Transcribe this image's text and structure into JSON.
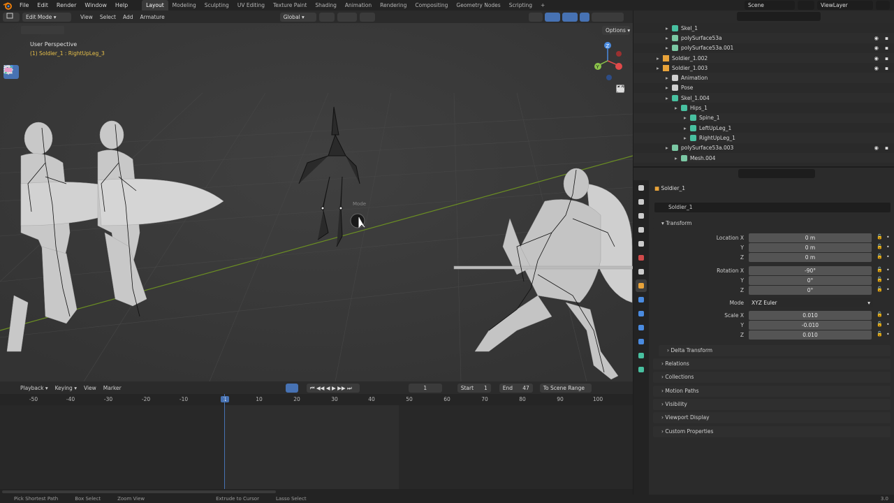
{
  "menu": [
    "File",
    "Edit",
    "Render",
    "Window",
    "Help"
  ],
  "workspaces": [
    "Layout",
    "Modeling",
    "Sculpting",
    "UV Editing",
    "Texture Paint",
    "Shading",
    "Animation",
    "Rendering",
    "Compositing",
    "Geometry Nodes",
    "Scripting",
    "+"
  ],
  "active_workspace": "Layout",
  "scene": "Scene",
  "view_layer": "ViewLayer",
  "viewport_header": {
    "mode": "Edit Mode",
    "menus": [
      "View",
      "Select",
      "Add",
      "Armature"
    ],
    "orientation": "Global",
    "options": "Options"
  },
  "viewport": {
    "perspective": "User Perspective",
    "active_object": "(1) Soldier_1 : RightUpLeg_3",
    "gizmo_label": "Mode",
    "axis_labels": {
      "z": "Z",
      "y": "Y",
      "x": "X"
    }
  },
  "timeline": {
    "menus": [
      "Playback",
      "Keying",
      "View",
      "Marker"
    ],
    "current_frame": "1",
    "start_label": "Start",
    "start": "1",
    "end_label": "End",
    "end": "47",
    "to_scene_range": "To Scene Range",
    "ruler": [
      "-50",
      "-40",
      "-30",
      "-20",
      "-10",
      "1",
      "10",
      "20",
      "30",
      "40",
      "50",
      "60",
      "70",
      "80",
      "90",
      "100"
    ],
    "playhead": "1"
  },
  "statusbar": [
    "Pick Shortest Path",
    "Box Select",
    "Zoom View",
    "Extrude to Cursor",
    "Lasso Select",
    "3.0"
  ],
  "outliner": {
    "rows": [
      {
        "label": "Skel_1",
        "indent": 2,
        "type": "armature",
        "eye": false
      },
      {
        "label": "polySurface53a",
        "indent": 2,
        "type": "mesh",
        "eye": true
      },
      {
        "label": "polySurface53a.001",
        "indent": 2,
        "type": "mesh",
        "eye": true
      },
      {
        "label": "Soldier_1.002",
        "indent": 1,
        "type": "object",
        "eye": true
      },
      {
        "label": "Soldier_1.003",
        "indent": 1,
        "type": "object",
        "eye": true
      },
      {
        "label": "Animation",
        "indent": 2,
        "type": "anim",
        "eye": false
      },
      {
        "label": "Pose",
        "indent": 2,
        "type": "pose",
        "eye": false
      },
      {
        "label": "Skel_1.004",
        "indent": 2,
        "type": "armature",
        "eye": false
      },
      {
        "label": "Hips_1",
        "indent": 3,
        "type": "bone",
        "eye": false
      },
      {
        "label": "Spine_1",
        "indent": 4,
        "type": "bone",
        "eye": false
      },
      {
        "label": "LeftUpLeg_1",
        "indent": 4,
        "type": "bone",
        "eye": false
      },
      {
        "label": "RightUpLeg_1",
        "indent": 4,
        "type": "bone",
        "eye": false
      },
      {
        "label": "polySurface53a.003",
        "indent": 2,
        "type": "mesh",
        "eye": true
      },
      {
        "label": "Mesh.004",
        "indent": 3,
        "type": "mesh",
        "eye": false
      }
    ]
  },
  "properties": {
    "object_name": "Soldier_1",
    "datablock": "Soldier_1",
    "transform_title": "Transform",
    "location": {
      "label": "Location X",
      "x": "0 m",
      "y": "0 m",
      "z": "0 m"
    },
    "rotation": {
      "label": "Rotation X",
      "x": "-90°",
      "y": "0°",
      "z": "0°"
    },
    "mode_label": "Mode",
    "mode": "XYZ Euler",
    "scale": {
      "label": "Scale X",
      "x": "0.010",
      "y": "-0.010",
      "z": "0.010"
    },
    "axis_y": "Y",
    "axis_z": "Z",
    "panels": [
      "Delta Transform",
      "Relations",
      "Collections",
      "Motion Paths",
      "Visibility",
      "Viewport Display",
      "Custom Properties"
    ]
  },
  "colors": {
    "accent": "#4772b3",
    "bone_orange": "#e8a33a",
    "bone_green": "#48c0a0",
    "mesh_green": "#7bc8a4",
    "axis_x": "#e04a4a",
    "axis_y": "#8bc34a",
    "axis_z": "#4a8be0"
  }
}
